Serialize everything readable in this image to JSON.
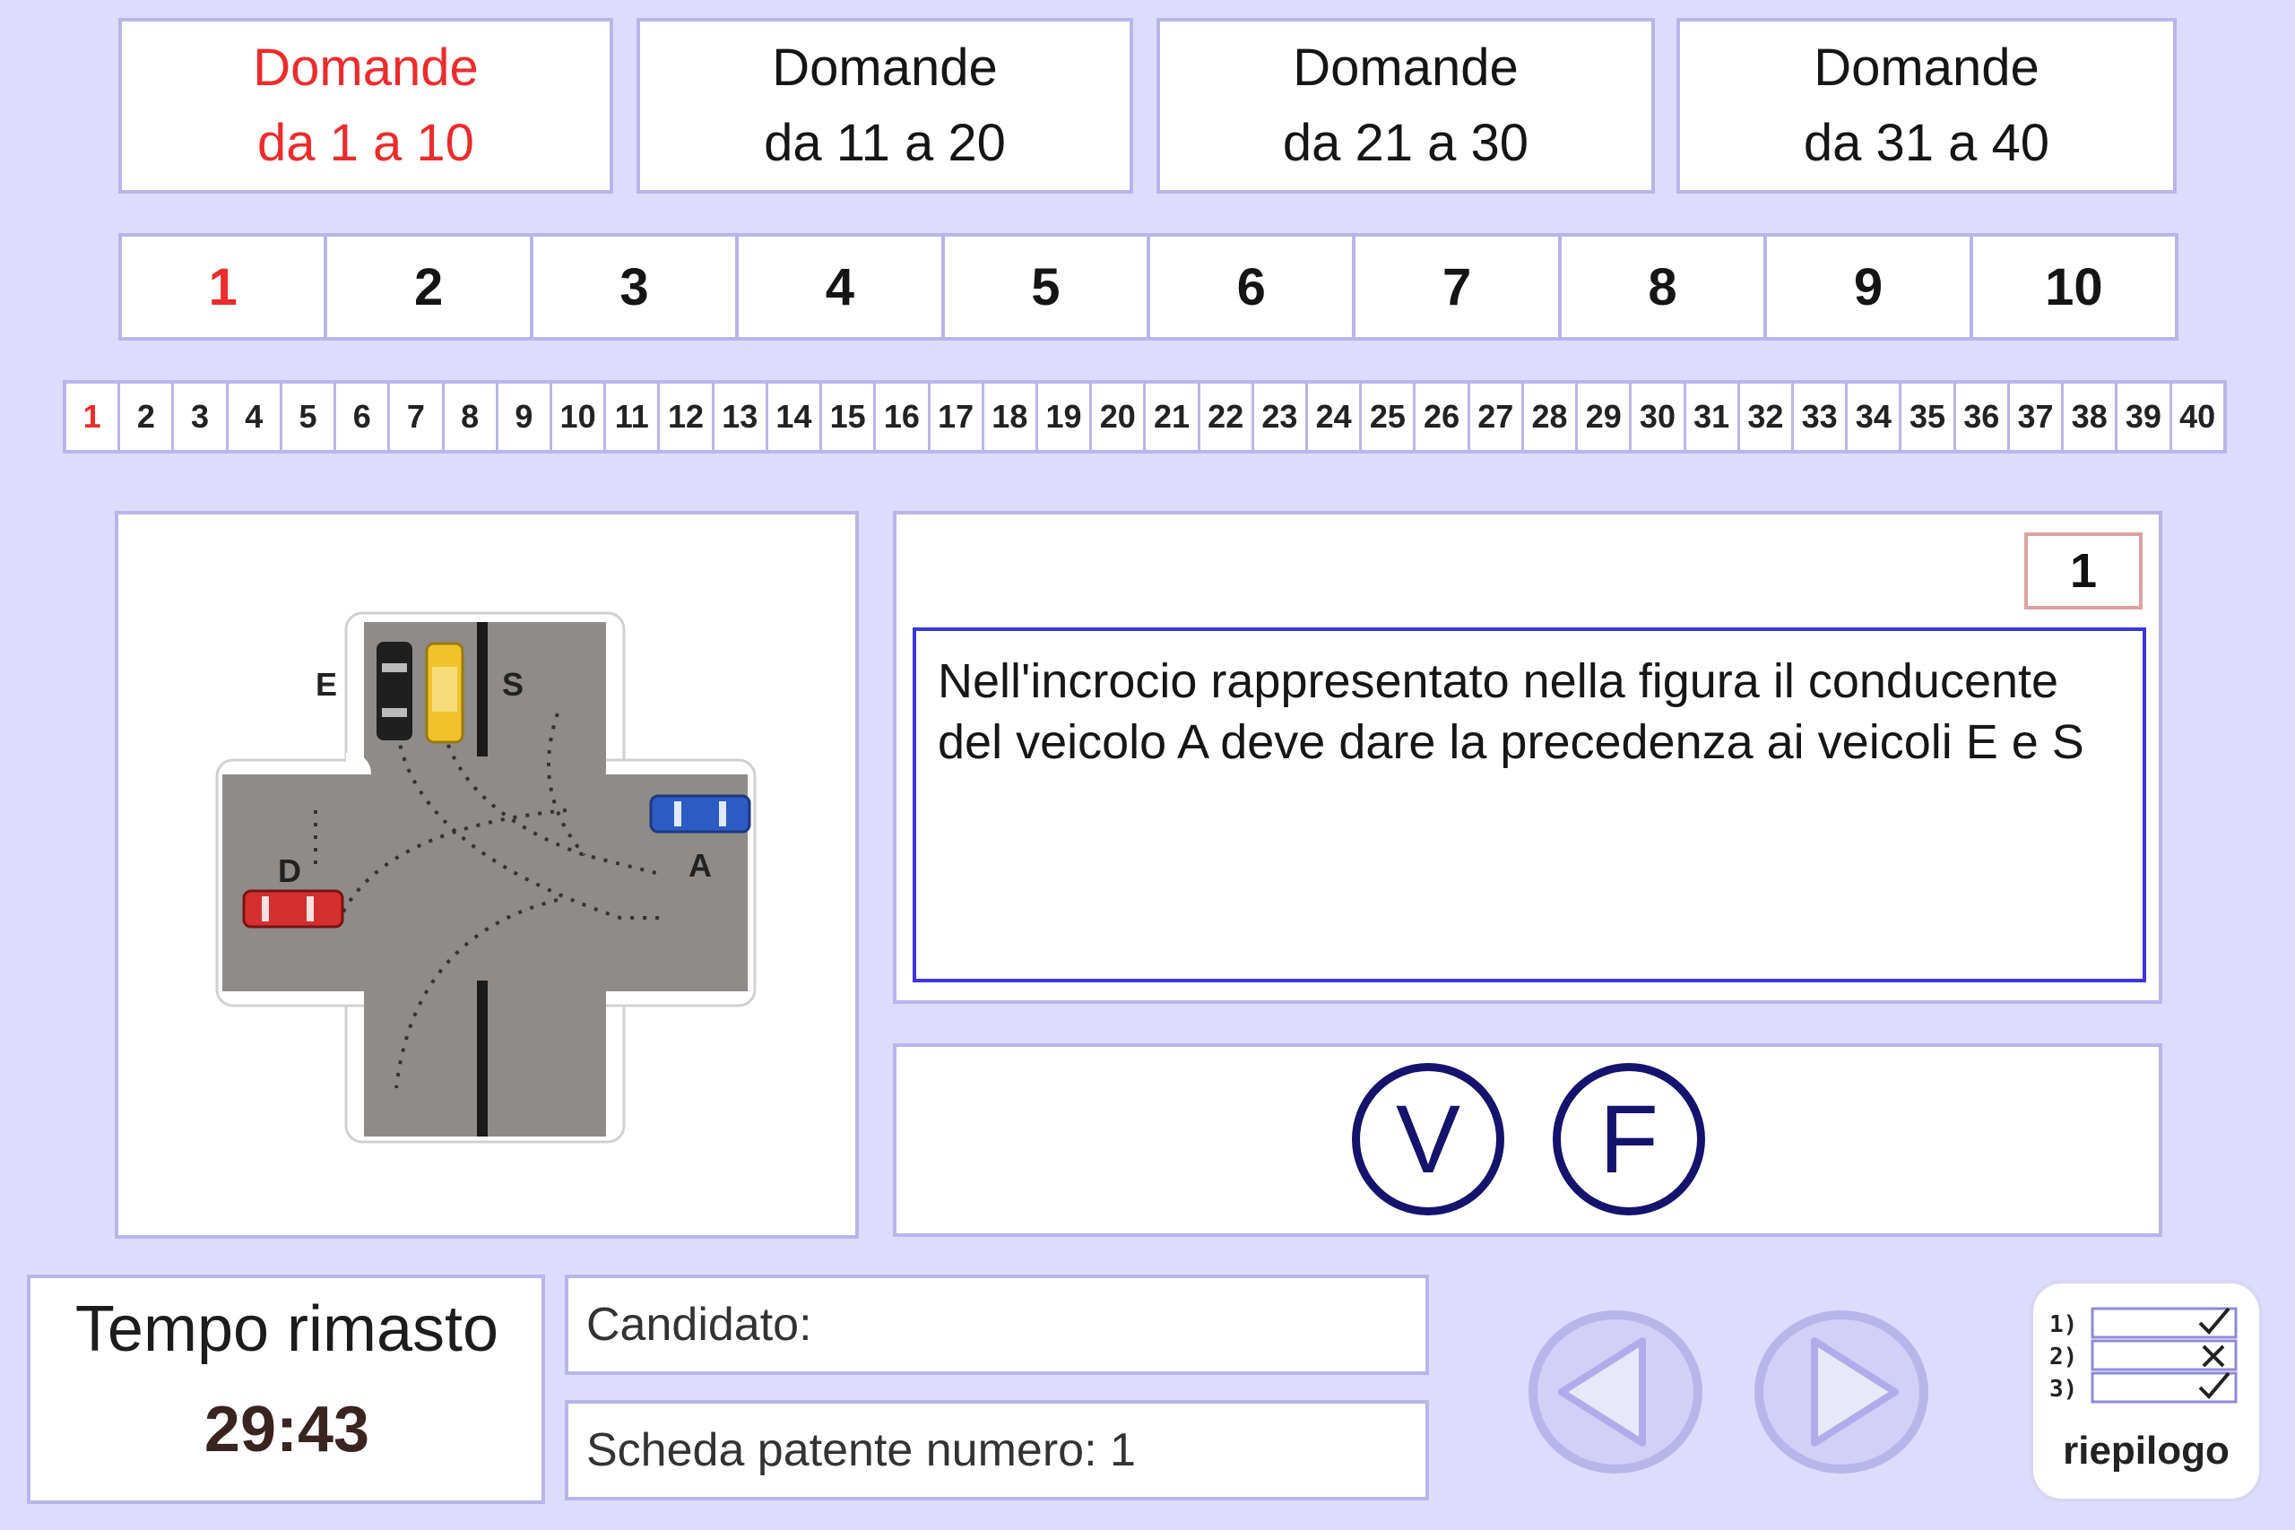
{
  "groups": [
    {
      "line1": "Domande",
      "line2": "da 1 a 10",
      "active": true
    },
    {
      "line1": "Domande",
      "line2": "da 11 a 20",
      "active": false
    },
    {
      "line1": "Domande",
      "line2": "da 21 a 30",
      "active": false
    },
    {
      "line1": "Domande",
      "line2": "da 31 a 40",
      "active": false
    }
  ],
  "question_tabs": [
    "1",
    "2",
    "3",
    "4",
    "5",
    "6",
    "7",
    "8",
    "9",
    "10"
  ],
  "question_tabs_active": 0,
  "mini_tabs": [
    "1",
    "2",
    "3",
    "4",
    "5",
    "6",
    "7",
    "8",
    "9",
    "10",
    "11",
    "12",
    "13",
    "14",
    "15",
    "16",
    "17",
    "18",
    "19",
    "20",
    "21",
    "22",
    "23",
    "24",
    "25",
    "26",
    "27",
    "28",
    "29",
    "30",
    "31",
    "32",
    "33",
    "34",
    "35",
    "36",
    "37",
    "38",
    "39",
    "40"
  ],
  "mini_tabs_active": 0,
  "figure": {
    "labels": {
      "e": "E",
      "s": "S",
      "d": "D",
      "a": "A"
    }
  },
  "question": {
    "number": "1",
    "text": "Nell'incrocio rappresentato nella figura il conducente del veicolo A deve dare la precedenza ai veicoli E e S"
  },
  "answers": {
    "true_label": "V",
    "false_label": "F"
  },
  "timer": {
    "label": "Tempo rimasto",
    "value": "29:43"
  },
  "candidate": {
    "label": "Candidato:"
  },
  "sheet": {
    "label": "Scheda patente numero: 1"
  },
  "summary": {
    "label": "riepilogo",
    "rows": [
      "1)",
      "2)",
      "3)"
    ]
  },
  "colors": {
    "active": "#ee2b2b",
    "border": "#b9b5ea",
    "background": "#dedcfd",
    "answer": "#14146e"
  }
}
